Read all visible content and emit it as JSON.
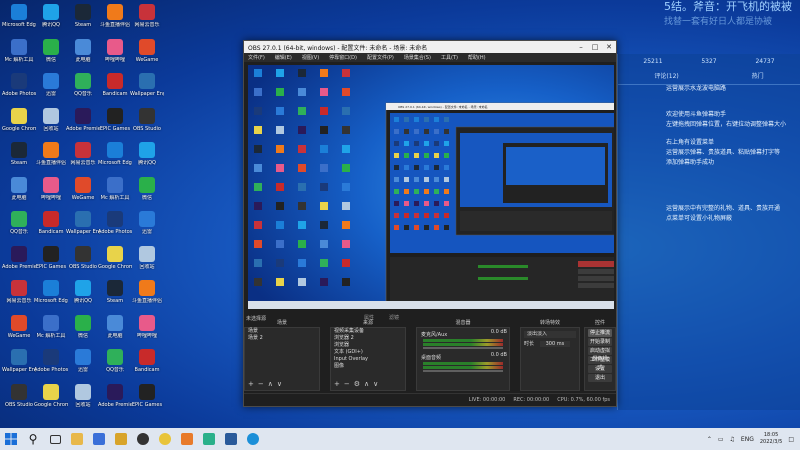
{
  "overlay": {
    "line1": "5结。斧音：开飞机的被被",
    "line2": "找替一套有好日人都是协被"
  },
  "side_panel": {
    "stats": [
      "25211",
      "5327",
      "24737"
    ],
    "tabs": [
      "评论(12)",
      "热门"
    ],
    "messages": [
      "运营展示水龙波电脑路",
      "欢迎使用斗鱼弹幕助手",
      "左键拖拽回弹幕位置，右键拉动调整弹幕大小",
      "右上角有设置菜单",
      "运营展示弹幕、贵族道具、粘贴弹幕打字等",
      "添加弹幕助手成功",
      "运营展示中有完整的礼物、道具、贵族开通",
      "点菜单可设置小礼物屏蔽"
    ]
  },
  "desktop": {
    "icons": [
      {
        "label": "Microsoft Edge",
        "color": "#1b7fd8"
      },
      {
        "label": "Mc 解析工具",
        "color": "#3b6fc9"
      },
      {
        "label": "Adobe Photoshop",
        "color": "#1a3a7a"
      },
      {
        "label": "Google Chrome",
        "color": "#e8d34a"
      },
      {
        "label": "Steam",
        "color": "#1b2838"
      },
      {
        "label": "此电脑",
        "color": "#4a8ad8"
      },
      {
        "label": "QQ音乐",
        "color": "#2fb05a"
      },
      {
        "label": "Adobe Premiere",
        "color": "#2a1a5a"
      },
      {
        "label": "网易云音乐",
        "color": "#c8323a"
      },
      {
        "label": "WeGame",
        "color": "#e04a2a"
      },
      {
        "label": "Wallpaper Engine",
        "color": "#2a6fb0"
      },
      {
        "label": "OBS Studio",
        "color": "#333333"
      },
      {
        "label": "腾讯QQ",
        "color": "#1fa3e8"
      },
      {
        "label": "微信",
        "color": "#2ab04a"
      },
      {
        "label": "迅雷",
        "color": "#2a7ad8"
      },
      {
        "label": "回收站",
        "color": "#b0c8e0"
      },
      {
        "label": "斗鱼直播伴侣",
        "color": "#f07a1a"
      },
      {
        "label": "哔哩哔哩",
        "color": "#e85a8a"
      },
      {
        "label": "Bandicam",
        "color": "#c82a2a"
      },
      {
        "label": "EPIC Games",
        "color": "#222222"
      }
    ]
  },
  "obs": {
    "title": "OBS 27.0.1 (64-bit, windows) - 配置文件: 未命名 - 场景: 未命名",
    "menu": [
      "文件(F)",
      "编辑(E)",
      "视图(V)",
      "停靠窗口(D)",
      "配置文件(P)",
      "场景集合(S)",
      "工具(T)",
      "帮助(H)"
    ],
    "inner_title": "OBS 27.0.1 (64-bit, windows) - 配置文件: 未命名 - 场景: 未命名",
    "preview_label": "未选择源",
    "properties_btn": "属性",
    "filters_btn": "滤镜",
    "docks": {
      "scenes": {
        "title": "场景",
        "items": [
          "场景",
          "场景 2"
        ]
      },
      "sources": {
        "title": "来源",
        "items": [
          "视频采集设备",
          "浏览器 2",
          "浏览器",
          "文本 (GDI+)",
          "Input Overlay",
          "图像"
        ]
      },
      "mixer": {
        "title": "混音器",
        "items": [
          {
            "name": "麦克风/Aux",
            "db": "0.0 dB"
          },
          {
            "name": "桌面音频",
            "db": "0.0 dB"
          }
        ]
      },
      "transitions": {
        "title": "转场特效",
        "type": "淡出淡入",
        "duration_label": "时长",
        "duration": "300 ms"
      },
      "controls": {
        "title": "控件",
        "buttons": [
          "停止推流",
          "开始录制",
          "启动虚拟摄像机",
          "工作室模式",
          "设置",
          "退出"
        ]
      }
    },
    "status": {
      "live": "LIVE: 00:00:00",
      "rec": "REC: 00:00:00",
      "cpu": "CPU: 0.7%, 60.00 fps"
    }
  },
  "taskbar": {
    "time": "18:05",
    "date": "2022/3/5",
    "lang": "ENG"
  }
}
